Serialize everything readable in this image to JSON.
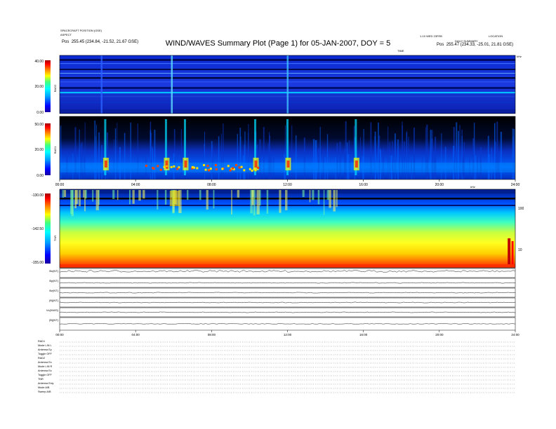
{
  "header": {
    "left_line1": "SPACECRAFT POSITION (GSE)",
    "left_line2": "ASPECT",
    "left_pos_label": "Pos",
    "left_pos_value": "255.45 (234.84, -21.52, 21.67 GSE)",
    "center_top": "1-10 WED 23FEB",
    "right_line1": "LOCATION",
    "right_line2": "DAILY SUMMARY",
    "right_pos_label": "Pos",
    "right_pos_value": "255.47 (234.33, -25.01, 21.81 GSE)",
    "title": "WIND/WAVES Summary Plot (Page 1) for 05-JAN-2007, DOY = 5",
    "ut_label": "TIME",
    "khz_label_top": "kHz",
    "khz_label_mid": "kHz"
  },
  "colors": {
    "bg_spectrum": "#0a1fb8",
    "black_gap": "#000000",
    "colorbar": [
      "#1a00a0",
      "#0000ff",
      "#00a0ff",
      "#00ffff",
      "#40ff80",
      "#ffff00",
      "#ff8000",
      "#ff0000",
      "#a00000"
    ]
  },
  "chart_data": [
    {
      "type": "heatmap",
      "panel": "RAD2",
      "ylabel": "RAD2",
      "colorbar_ticks": [
        "40.00",
        "20.00",
        "0.00"
      ],
      "colorbar_range": [
        0,
        40
      ]
    },
    {
      "type": "heatmap",
      "panel": "RAD1",
      "ylabel": "RAD1",
      "colorbar_ticks": [
        "50.00",
        "20.00",
        "0.00"
      ],
      "colorbar_range": [
        0,
        50
      ],
      "x_ticks": [
        "00:00",
        "04:00",
        "08:00",
        "12:00",
        "16:00",
        "20:00",
        "24:00"
      ],
      "xlim": [
        0,
        24
      ],
      "bursts_hours": [
        2.4,
        5.6,
        6.6,
        10.3,
        12.0,
        15.6
      ]
    },
    {
      "type": "heatmap",
      "panel": "TNR",
      "ylabel": "TNR",
      "colorbar_ticks": [
        "-130.00",
        "-142.50",
        "-155.00"
      ],
      "colorbar_range": [
        -155,
        -130
      ],
      "right_ticks": [
        "100",
        "10"
      ]
    },
    {
      "type": "line",
      "panel": "housekeeping",
      "x_ticks": [
        "00:00",
        "04:00",
        "08:00",
        "12:00",
        "16:00",
        "20:00",
        "24:00"
      ],
      "xlim": [
        0,
        24
      ],
      "series": [
        {
          "name": "Bx(NT)",
          "baseline": 0.3
        },
        {
          "name": "By(NT)",
          "baseline": 0.5
        },
        {
          "name": "Bz(NT)",
          "baseline": 0.5
        },
        {
          "name": "|B|(NT)",
          "baseline": 0.5
        },
        {
          "name": "Vx(KM/S)",
          "baseline": 0.5
        },
        {
          "name": "|B|(NT)",
          "baseline": 0.5
        }
      ]
    }
  ],
  "footer": {
    "lines": [
      "RAD1",
      "Mode   LIN L",
      "Antenna  Ey",
      "Toggle  OFF",
      "RAD2",
      "Antenna  Ex",
      "Mode  LIN R",
      "Antenna  Ez",
      "Toggle  OFF",
      "TNR",
      "Antenna  Exiy",
      "Mode   A/B",
      "Sweep   A/B"
    ]
  }
}
